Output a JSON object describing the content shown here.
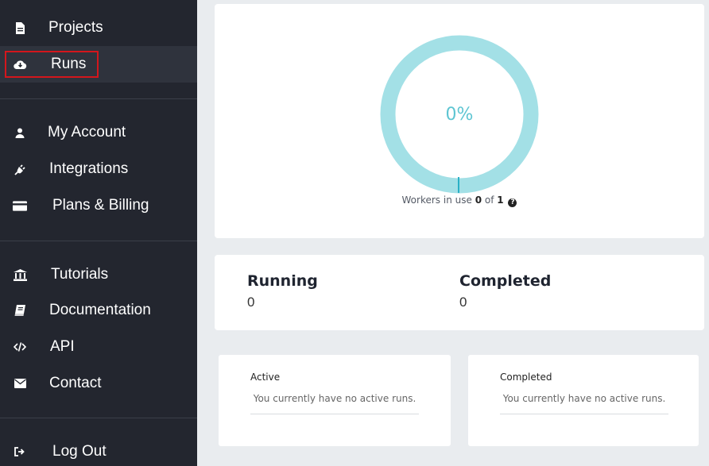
{
  "sidebar": {
    "items": [
      {
        "label": "Projects",
        "icon": "file-icon"
      },
      {
        "label": "Runs",
        "icon": "cloud-download-icon",
        "active": true
      },
      {
        "label": "My Account",
        "icon": "user-icon"
      },
      {
        "label": "Integrations",
        "icon": "plug-icon"
      },
      {
        "label": "Plans & Billing",
        "icon": "credit-card-icon"
      },
      {
        "label": "Tutorials",
        "icon": "bank-icon"
      },
      {
        "label": "Documentation",
        "icon": "book-icon"
      },
      {
        "label": "API",
        "icon": "code-icon"
      },
      {
        "label": "Contact",
        "icon": "envelope-icon"
      },
      {
        "label": "Log Out",
        "icon": "sign-out-icon"
      }
    ]
  },
  "gauge": {
    "percent_label": "0%",
    "percent_value": 0,
    "workers_prefix": "Workers in use",
    "workers_used": "0",
    "workers_of": "of",
    "workers_total": "1",
    "ring_color": "#a3e0e6",
    "marker_color": "#2ab0c6"
  },
  "stats": {
    "running": {
      "title": "Running",
      "value": "0"
    },
    "completed": {
      "title": "Completed",
      "value": "0"
    }
  },
  "lists": {
    "active": {
      "title": "Active",
      "empty_message": "You currently have no active runs."
    },
    "completed": {
      "title": "Completed",
      "empty_message": "You currently have no active runs."
    }
  },
  "colors": {
    "sidebar_bg": "#23262f",
    "active_outline": "#d4161c",
    "page_bg": "#e9ecef"
  }
}
